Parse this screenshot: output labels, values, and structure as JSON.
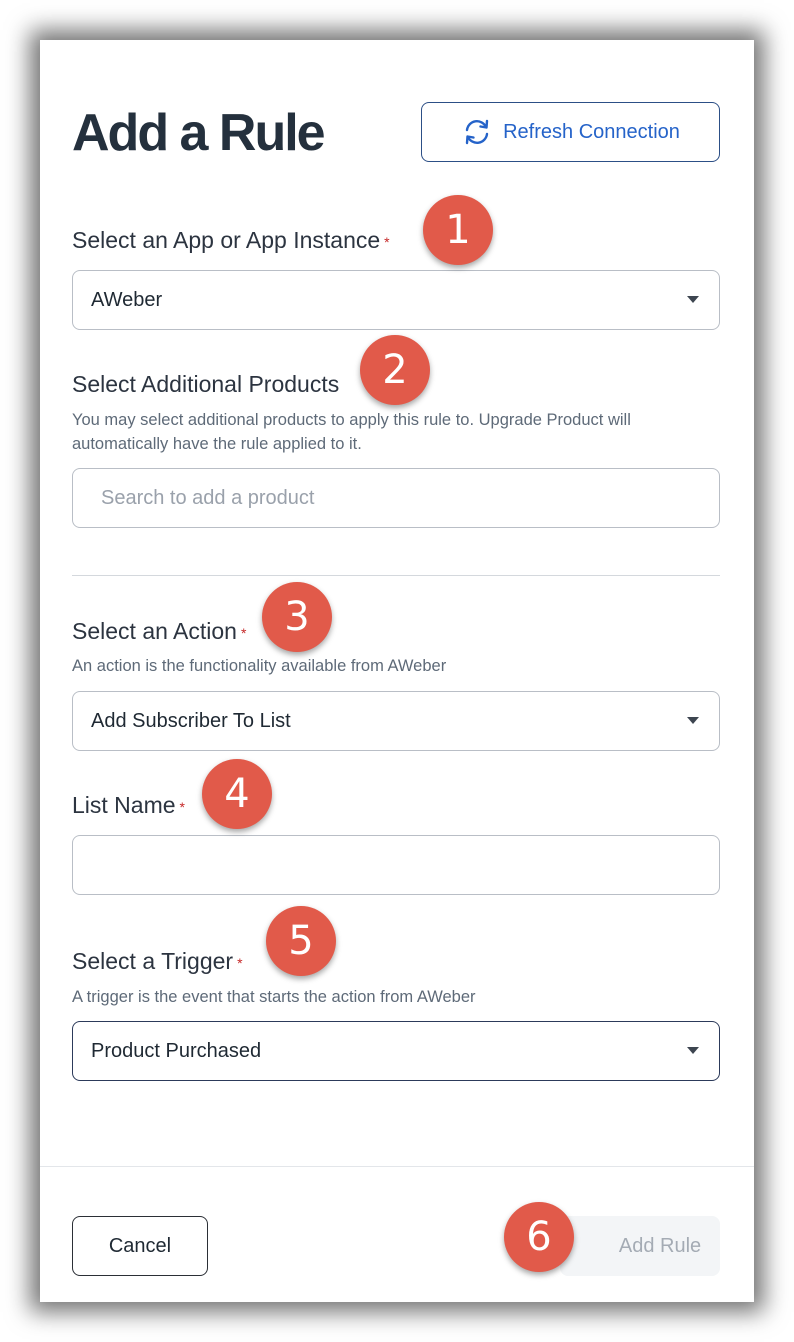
{
  "dialog": {
    "title": "Add a Rule",
    "refresh_label": "Refresh Connection"
  },
  "app_field": {
    "label": "Select an App or App Instance",
    "required": "*",
    "value": "AWeber"
  },
  "products_field": {
    "label": "Select Additional Products",
    "help": "You may select additional products to apply this rule to. Upgrade Product will automatically have the rule applied to it.",
    "placeholder": "Search to add a product"
  },
  "action_field": {
    "label": "Select an Action",
    "required": "*",
    "help": "An action is the functionality available from AWeber",
    "value": "Add Subscriber To List"
  },
  "list_field": {
    "label": "List Name",
    "required": "*",
    "value": ""
  },
  "trigger_field": {
    "label": "Select a Trigger",
    "required": "*",
    "help": "A trigger is the event that starts the action from AWeber",
    "value": "Product Purchased"
  },
  "footer": {
    "cancel_label": "Cancel",
    "add_label": "Add Rule"
  },
  "badges": [
    "1",
    "2",
    "3",
    "4",
    "5",
    "6"
  ],
  "colors": {
    "accent": "#2563c9",
    "badge": "#e15a4a",
    "title": "#24303d",
    "required": "#c62828"
  }
}
